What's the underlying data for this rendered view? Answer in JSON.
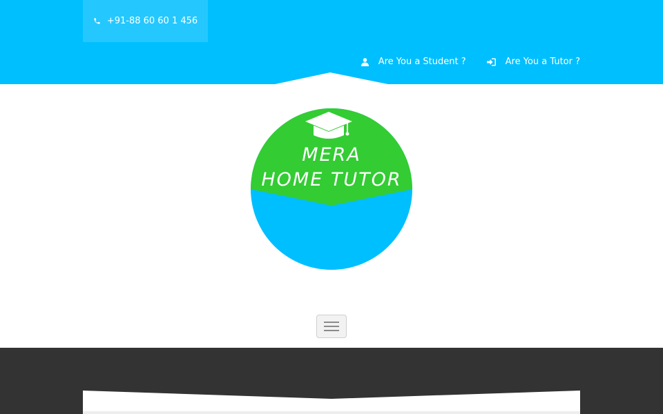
{
  "header": {
    "phone": "+91-88 60 60 1 456",
    "nav": [
      {
        "label": "Are You a Student ?",
        "icon": "user-icon"
      },
      {
        "label": "Are You a Tutor ?",
        "icon": "sign-in-icon"
      }
    ]
  },
  "logo": {
    "line1": "MERA",
    "line2": "HOME TUTOR",
    "icon": "graduation-cap-icon"
  },
  "colors": {
    "primary_blue": "#00bfff",
    "logo_green": "#33cc33",
    "dark_band": "#333333"
  }
}
